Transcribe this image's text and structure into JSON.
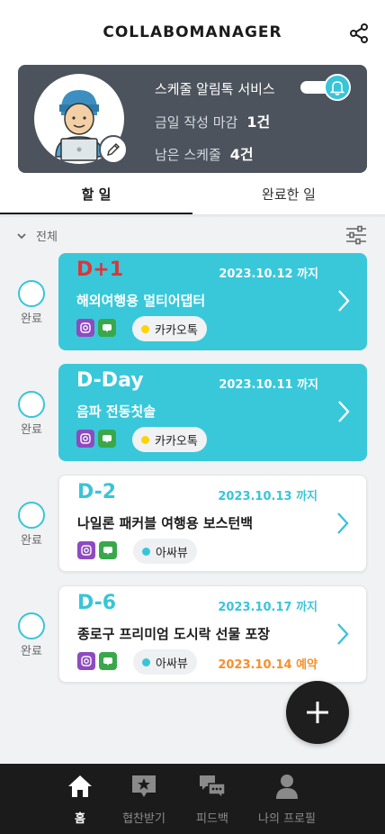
{
  "app": {
    "title": "COLLABOMANAGER"
  },
  "profile": {
    "service_label": "스케줄 알림톡 서비스",
    "service_enabled": true,
    "deadline_label": "금일 작성 마감",
    "deadline_value": "1건",
    "remaining_label": "남은 스케줄",
    "remaining_value": "4건"
  },
  "tabs": [
    {
      "label": "할 일",
      "active": true
    },
    {
      "label": "완료한 일",
      "active": false
    }
  ],
  "filter": {
    "label": "전체"
  },
  "check_label": "완료",
  "tasks": [
    {
      "dday": "D+1",
      "due": "2023.10.12 까지",
      "name": "해외여행용 멀티어댑터",
      "channel": "카카오톡",
      "channel_color": "#ffd400",
      "active": true,
      "dday_color": "#e0343a",
      "reserved": ""
    },
    {
      "dday": "D-Day",
      "due": "2023.10.11 까지",
      "name": "음파 전동칫솔",
      "channel": "카카오톡",
      "channel_color": "#ffd400",
      "active": true,
      "dday_color": "#ffffff",
      "reserved": ""
    },
    {
      "dday": "D-2",
      "due": "2023.10.13 까지",
      "name": "나일론 패커블 여행용 보스턴백",
      "channel": "아싸뷰",
      "channel_color": "#38c5d8",
      "active": false,
      "dday_color": "#38c5d8",
      "reserved": ""
    },
    {
      "dday": "D-6",
      "due": "2023.10.17 까지",
      "name": "종로구 프리미엄 도시락 선물 포장",
      "channel": "아싸뷰",
      "channel_color": "#38c5d8",
      "active": false,
      "dday_color": "#38c5d8",
      "reserved": "2023.10.14 예약"
    }
  ],
  "nav": [
    {
      "label": "홈",
      "icon": "home-icon",
      "active": true
    },
    {
      "label": "협찬받기",
      "icon": "star-icon",
      "active": false
    },
    {
      "label": "피드백",
      "icon": "chat-icon",
      "active": false
    },
    {
      "label": "나의 프로필",
      "icon": "person-icon",
      "active": false
    }
  ],
  "colors": {
    "accent": "#38c8da",
    "dark": "#4c535d",
    "nav_bg": "#1b1b1b",
    "reserve": "#f5902b"
  }
}
